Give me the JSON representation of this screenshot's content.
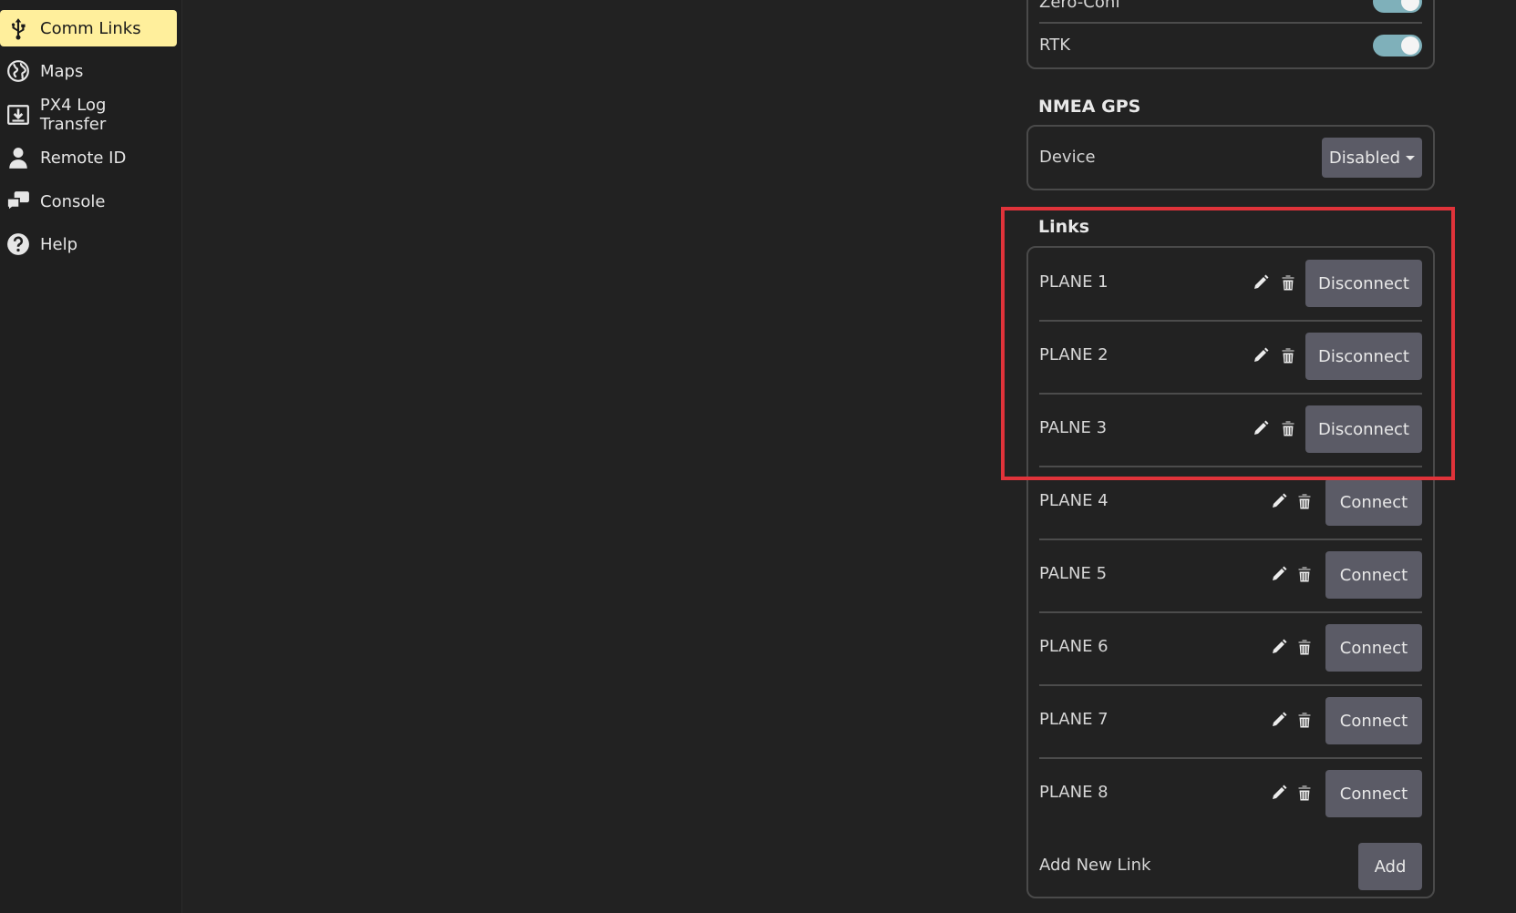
{
  "sidebar": {
    "items": [
      {
        "label": "Comm Links",
        "icon": "usb-icon",
        "active": true
      },
      {
        "label": "Maps",
        "icon": "globe-icon",
        "active": false
      },
      {
        "label": "PX4 Log Transfer",
        "icon": "download-icon",
        "active": false
      },
      {
        "label": "Remote ID",
        "icon": "person-icon",
        "active": false
      },
      {
        "label": "Console",
        "icon": "chat-icon",
        "active": false
      },
      {
        "label": "Help",
        "icon": "help-icon",
        "active": false
      }
    ]
  },
  "autoconnect": {
    "zero_conf_label": "Zero-Conf",
    "rtk_label": "RTK"
  },
  "nmea": {
    "title": "NMEA GPS",
    "device_label": "Device",
    "device_value": "Disabled"
  },
  "links": {
    "title": "Links",
    "items": [
      {
        "name": "PLANE 1",
        "action": "Disconnect"
      },
      {
        "name": "PLANE 2",
        "action": "Disconnect"
      },
      {
        "name": "PALNE 3",
        "action": "Disconnect"
      },
      {
        "name": "PLANE 4",
        "action": "Connect"
      },
      {
        "name": "PALNE 5",
        "action": "Connect"
      },
      {
        "name": "PLANE 6",
        "action": "Connect"
      },
      {
        "name": "PLANE 7",
        "action": "Connect"
      },
      {
        "name": "PLANE 8",
        "action": "Connect"
      }
    ],
    "add_label": "Add New Link",
    "add_button": "Add"
  },
  "colors": {
    "accent": "#ffef9c",
    "highlight": "#e0333a",
    "toggle_on": "#7fb0ba",
    "button": "#5b5b66"
  }
}
